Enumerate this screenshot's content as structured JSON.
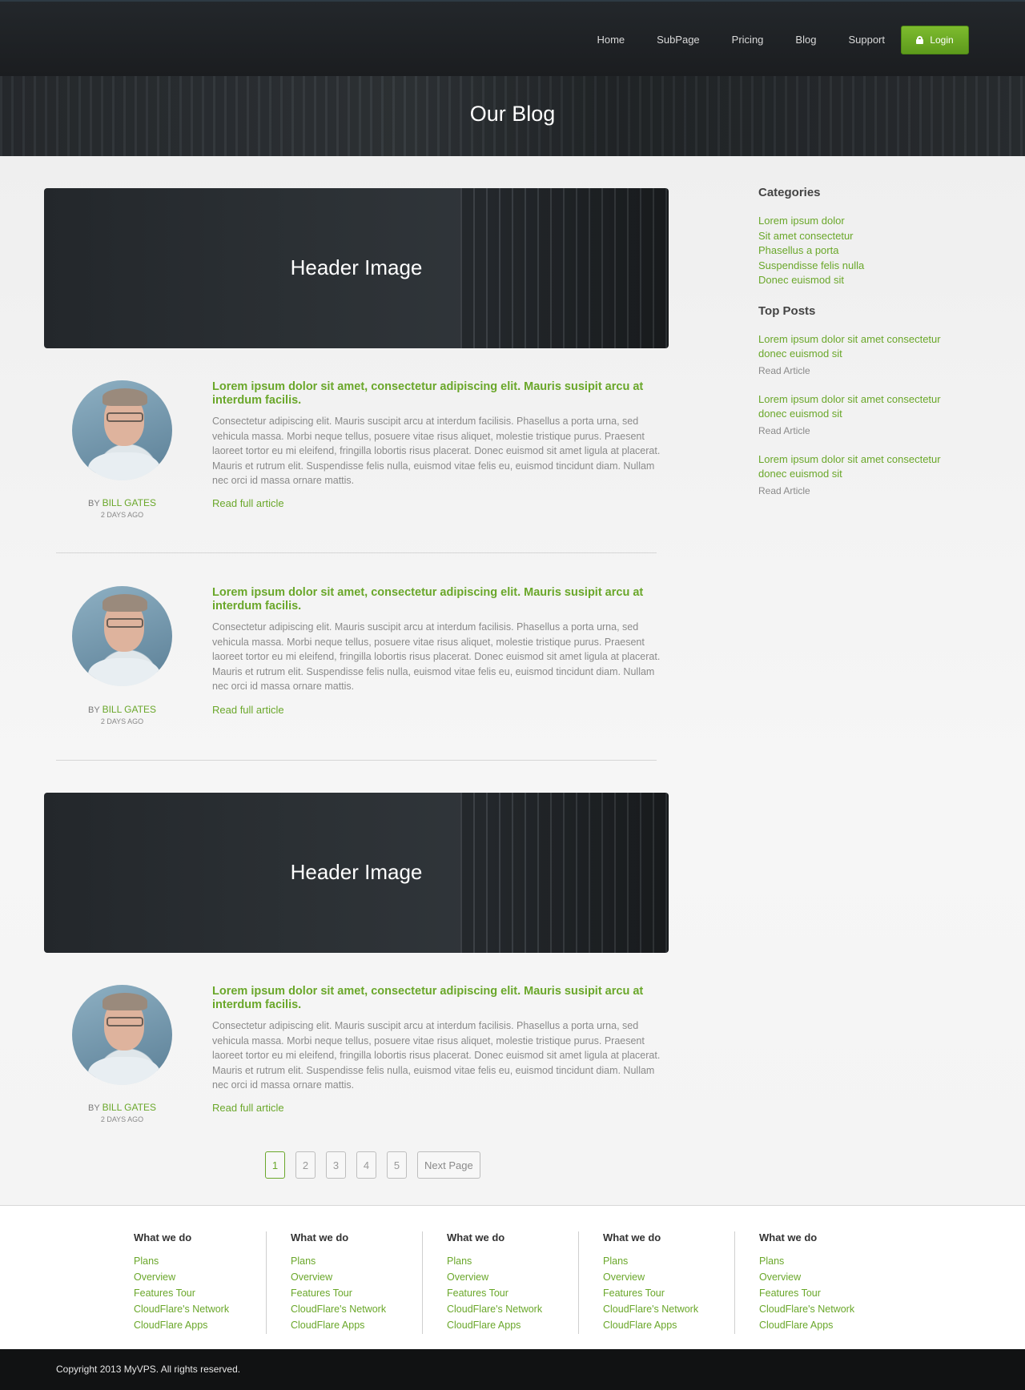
{
  "nav": {
    "links": [
      "Home",
      "SubPage",
      "Pricing",
      "Blog",
      "Support"
    ],
    "login_label": "Login"
  },
  "hero": {
    "title": "Our Blog"
  },
  "header_image_label": "Header Image",
  "posts": [
    {
      "title": "Lorem ipsum dolor sit amet, consectetur adipiscing elit. Mauris susipit arcu at interdum facilis.",
      "body": "Consectetur adipiscing elit. Mauris suscipit arcu at interdum facilisis. Phasellus a porta urna, sed vehicula massa. Morbi neque tellus, posuere vitae risus aliquet, molestie tristique purus. Praesent laoreet tortor eu mi eleifend, fringilla lobortis risus placerat. Donec euismod sit amet ligula at placerat. Mauris et rutrum elit. Suspendisse felis nulla, euismod vitae felis eu, euismod tincidunt diam. Nullam nec orci id massa ornare mattis.",
      "by": "BY",
      "author": "BILL GATES",
      "date": "2 DAYS AGO",
      "read_more": "Read full article"
    },
    {
      "title": "Lorem ipsum dolor sit amet, consectetur adipiscing elit. Mauris susipit arcu at interdum facilis.",
      "body": "Consectetur adipiscing elit. Mauris suscipit arcu at interdum facilisis. Phasellus a porta urna, sed vehicula massa. Morbi neque tellus, posuere vitae risus aliquet, molestie tristique purus. Praesent laoreet tortor eu mi eleifend, fringilla lobortis risus placerat. Donec euismod sit amet ligula at placerat. Mauris et rutrum elit. Suspendisse felis nulla, euismod vitae felis eu, euismod tincidunt diam. Nullam nec orci id massa ornare mattis.",
      "by": "BY",
      "author": "BILL GATES",
      "date": "2 DAYS AGO",
      "read_more": "Read full article"
    },
    {
      "title": "Lorem ipsum dolor sit amet, consectetur adipiscing elit. Mauris susipit arcu at interdum facilis.",
      "body": "Consectetur adipiscing elit. Mauris suscipit arcu at interdum facilisis. Phasellus a porta urna, sed vehicula massa. Morbi neque tellus, posuere vitae risus aliquet, molestie tristique purus. Praesent laoreet tortor eu mi eleifend, fringilla lobortis risus placerat. Donec euismod sit amet ligula at placerat. Mauris et rutrum elit. Suspendisse felis nulla, euismod vitae felis eu, euismod tincidunt diam. Nullam nec orci id massa ornare mattis.",
      "by": "BY",
      "author": "BILL GATES",
      "date": "2 DAYS AGO",
      "read_more": "Read full article"
    }
  ],
  "pagination": {
    "pages": [
      "1",
      "2",
      "3",
      "4",
      "5"
    ],
    "current": "1",
    "next_label": "Next Page"
  },
  "sidebar": {
    "categories_heading": "Categories",
    "categories": [
      "Lorem ipsum dolor",
      "Sit amet consectetur",
      "Phasellus a porta",
      "Suspendisse felis nulla",
      "Donec euismod sit"
    ],
    "top_posts_heading": "Top Posts",
    "top_posts": [
      {
        "title_line1": "Lorem ipsum dolor sit amet consectetur",
        "title_line2": "donec euismod sit",
        "read": "Read Article"
      },
      {
        "title_line1": "Lorem ipsum dolor sit amet consectetur",
        "title_line2": "donec euismod sit",
        "read": "Read Article"
      },
      {
        "title_line1": "Lorem ipsum dolor sit amet consectetur",
        "title_line2": "donec euismod sit",
        "read": "Read Article"
      }
    ]
  },
  "footer": {
    "columns": [
      {
        "heading": "What we do",
        "links": [
          "Plans",
          "Overview",
          "Features Tour",
          "CloudFlare's Network",
          "CloudFlare Apps"
        ]
      },
      {
        "heading": "What we do",
        "links": [
          "Plans",
          "Overview",
          "Features Tour",
          "CloudFlare's Network",
          "CloudFlare Apps"
        ]
      },
      {
        "heading": "What we do",
        "links": [
          "Plans",
          "Overview",
          "Features Tour",
          "CloudFlare's Network",
          "CloudFlare Apps"
        ]
      },
      {
        "heading": "What we do",
        "links": [
          "Plans",
          "Overview",
          "Features Tour",
          "CloudFlare's Network",
          "CloudFlare Apps"
        ]
      },
      {
        "heading": "What we do",
        "links": [
          "Plans",
          "Overview",
          "Features Tour",
          "CloudFlare's Network",
          "CloudFlare Apps"
        ]
      }
    ],
    "copyright": "Copyright 2013 MyVPS. All rights reserved."
  },
  "colors": {
    "accent": "#6aa72a",
    "login_button": "#6aaa24",
    "navbar": "#1e2124",
    "footer_bar": "#111213"
  }
}
